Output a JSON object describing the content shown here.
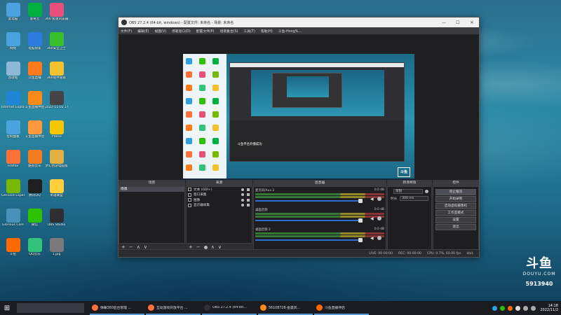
{
  "desktop": {
    "icons": [
      {
        "label": "此电脑",
        "icon": "computer-icon",
        "color": "#4aa3df"
      },
      {
        "label": "爱奇艺",
        "icon": "iqiyi-icon",
        "color": "#00b140"
      },
      {
        "label": "360 极速浏览器",
        "icon": "browser-icon",
        "color": "#e84f7a"
      },
      {
        "label": "网络",
        "icon": "network-icon",
        "color": "#4aa3df"
      },
      {
        "label": "电脑管家",
        "icon": "shield-icon",
        "color": "#2d7de0"
      },
      {
        "label": "360安全卫士",
        "icon": "360-icon",
        "color": "#38c02c"
      },
      {
        "label": "回收站",
        "icon": "recycle-bin-icon",
        "color": "#8fb8d8"
      },
      {
        "label": "斗鱼直播",
        "icon": "douyu-icon",
        "color": "#ff7a1a"
      },
      {
        "label": "360软件管家",
        "icon": "app-store-icon",
        "color": "#f2c12e"
      },
      {
        "label": "Internet Explorer",
        "icon": "ie-icon",
        "color": "#1f86d6"
      },
      {
        "label": "斗鱼直播伴侣",
        "icon": "douyu-companion-icon",
        "color": "#ff8a1a"
      },
      {
        "label": "2022-11-02 14-17-42...",
        "icon": "video-icon",
        "color": "#444"
      },
      {
        "label": "控制面板",
        "icon": "control-panel-icon",
        "color": "#4aa3df"
      },
      {
        "label": "斗鱼直播伴侣",
        "icon": "douyu-companion-icon",
        "color": "#ff9a3c"
      },
      {
        "label": "YYelse",
        "icon": "yy-icon",
        "color": "#f6c700"
      },
      {
        "label": "Firefox",
        "icon": "firefox-icon",
        "color": "#ff7139"
      },
      {
        "label": "酷狗音乐",
        "icon": "kugou-icon",
        "color": "#f37c22"
      },
      {
        "label": "梦幻西游电脑版",
        "icon": "game-icon",
        "color": "#e0b040"
      },
      {
        "label": "GeForce Experience",
        "icon": "nvidia-icon",
        "color": "#76b900"
      },
      {
        "label": "腾讯QQ",
        "icon": "qq-icon",
        "color": "#1f1f1f"
      },
      {
        "label": "英雄联盟",
        "icon": "game-icon",
        "color": "#ffcf3c"
      },
      {
        "label": "Glorious Core",
        "icon": "glorious-icon",
        "color": "#4a90b8"
      },
      {
        "label": "微信",
        "icon": "wechat-icon",
        "color": "#2dc100"
      },
      {
        "label": "OBS Studio",
        "icon": "obs-icon",
        "color": "#302e31"
      },
      {
        "label": "斗鱼",
        "icon": "douyu-app-icon",
        "color": "#ff6a00"
      },
      {
        "label": "QQ音乐",
        "icon": "qq-music-icon",
        "color": "#31c27c"
      },
      {
        "label": "1.jpg",
        "icon": "image-icon",
        "color": "#7a7a7a"
      }
    ]
  },
  "obs": {
    "title": "OBS 27.2.4 (64-bit, windows) - 配置文件: 未命名 - 场景: 未命名",
    "menu": [
      "文件(F)",
      "编辑(E)",
      "视图(V)",
      "停靠窗口(D)",
      "配置文件(P)",
      "场景集合(S)",
      "工具(T)",
      "帮助(H)",
      "斗鱼-Hong%..."
    ],
    "window_buttons": [
      "—",
      "☐",
      "✕"
    ],
    "preview_toast": "斗鱼平台开播成功",
    "preview_logo": "斗鱼",
    "source_bar": {
      "label": "未选择源",
      "props": "属性",
      "filters": "滤镜"
    },
    "docks": {
      "scenes": {
        "title": "场景",
        "items": [
          "场景"
        ]
      },
      "sources": {
        "title": "来源",
        "items": [
          "文本 (GDI+)",
          "窗口采集",
          "图像",
          "显示器采集"
        ]
      },
      "mixer": {
        "title": "混音器",
        "channels": [
          {
            "name": "麦克风/Aux 2",
            "db": "0.0 dB"
          },
          {
            "name": "桌面音频",
            "db": "0.0 dB"
          },
          {
            "name": "桌面音频 2",
            "db": "0.0 dB"
          }
        ]
      },
      "transitions": {
        "title": "转场特效",
        "fade": "渐隐",
        "duration_label": "时长",
        "duration_value": "300 ms"
      },
      "controls": {
        "title": "控件",
        "buttons": [
          "停止推流",
          "开始录制",
          "启动虚拟摄像机",
          "工作室模式",
          "设置",
          "退出"
        ]
      }
    },
    "footer_icons": [
      "+",
      "−",
      "∧",
      "∨"
    ],
    "status": {
      "dropped": "LIVE: 00:00:00",
      "rec": "REC: 00:00:00",
      "cpu": "CPU: 0.7%, 60.00 fps",
      "kbps": "kb/s"
    }
  },
  "douyu_logo": {
    "mark": "斗鱼",
    "word": "DOUYU.COM",
    "number": "5913940"
  },
  "taskbar": {
    "items": [
      {
        "label": "弹幕360后台管理 ...",
        "color": "#ff7139"
      },
      {
        "label": "互动游戏开放平台 ...",
        "color": "#ff7139"
      },
      {
        "label": "OBS 27.2.4 (64-bit...",
        "color": "#302e31"
      },
      {
        "label": "56108728-金晨风...",
        "color": "#ff8a1a"
      },
      {
        "label": "斗鱼直播伴侣",
        "color": "#ff6a00"
      }
    ],
    "clock_time": "14:18",
    "clock_date": "2022/11/2"
  }
}
